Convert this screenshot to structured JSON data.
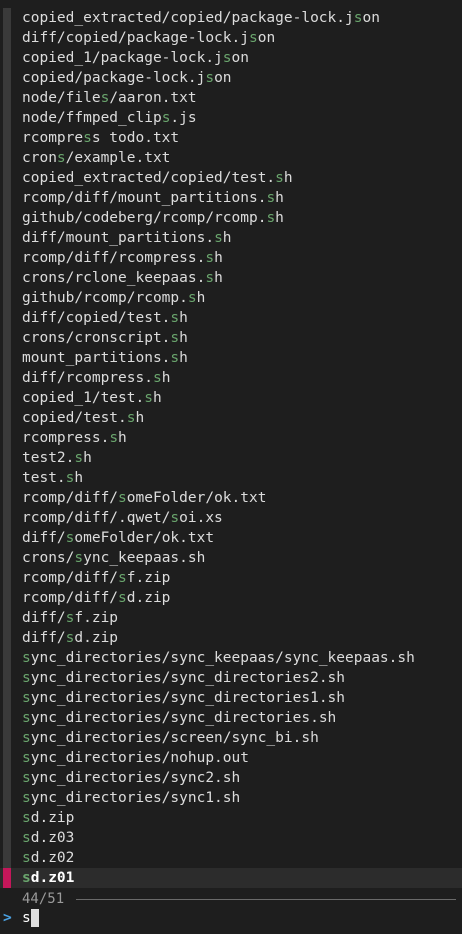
{
  "results": [
    [
      "copied_extracted/copied/package-lock.j",
      "s",
      "on"
    ],
    [
      "diff/copied/package-lock.j",
      "s",
      "on"
    ],
    [
      "copied_1/package-lock.j",
      "s",
      "on"
    ],
    [
      "copied/package-lock.j",
      "s",
      "on"
    ],
    [
      "node/file",
      "s",
      "/aaron.txt"
    ],
    [
      "node/ffmped_clip",
      "s",
      ".js"
    ],
    [
      "rcompre",
      "s",
      "s todo.txt"
    ],
    [
      "cron",
      "s",
      "/example.txt"
    ],
    [
      "copied_extracted/copied/test.",
      "s",
      "h"
    ],
    [
      "rcomp/diff/mount_partitions.",
      "s",
      "h"
    ],
    [
      "github/codeberg/rcomp/rcomp.",
      "s",
      "h"
    ],
    [
      "diff/mount_partitions.",
      "s",
      "h"
    ],
    [
      "rcomp/diff/rcompress.",
      "s",
      "h"
    ],
    [
      "crons/rclone_keepaas.",
      "s",
      "h"
    ],
    [
      "github/rcomp/rcomp.",
      "s",
      "h"
    ],
    [
      "diff/copied/test.",
      "s",
      "h"
    ],
    [
      "crons/cronscript.",
      "s",
      "h"
    ],
    [
      "mount_partitions.",
      "s",
      "h"
    ],
    [
      "diff/rcompress.",
      "s",
      "h"
    ],
    [
      "copied_1/test.",
      "s",
      "h"
    ],
    [
      "copied/test.",
      "s",
      "h"
    ],
    [
      "rcompress.",
      "s",
      "h"
    ],
    [
      "test2.",
      "s",
      "h"
    ],
    [
      "test.",
      "s",
      "h"
    ],
    [
      "rcomp/diff/",
      "s",
      "omeFolder/ok.txt"
    ],
    [
      "rcomp/diff/.qwet/",
      "s",
      "oi.xs"
    ],
    [
      "diff/",
      "s",
      "omeFolder/ok.txt"
    ],
    [
      "crons/",
      "s",
      "ync_keepaas.sh"
    ],
    [
      "rcomp/diff/",
      "s",
      "f.zip"
    ],
    [
      "rcomp/diff/",
      "s",
      "d.zip"
    ],
    [
      "diff/",
      "s",
      "f.zip"
    ],
    [
      "diff/",
      "s",
      "d.zip"
    ],
    [
      "",
      "s",
      "ync_directories/sync_keepaas/sync_keepaas.sh"
    ],
    [
      "",
      "s",
      "ync_directories/sync_directories2.sh"
    ],
    [
      "",
      "s",
      "ync_directories/sync_directories1.sh"
    ],
    [
      "",
      "s",
      "ync_directories/sync_directories.sh"
    ],
    [
      "",
      "s",
      "ync_directories/screen/sync_bi.sh"
    ],
    [
      "",
      "s",
      "ync_directories/nohup.out"
    ],
    [
      "",
      "s",
      "ync_directories/sync2.sh"
    ],
    [
      "",
      "s",
      "ync_directories/sync1.sh"
    ],
    [
      "",
      "s",
      "d.zip"
    ],
    [
      "",
      "s",
      "d.z03"
    ],
    [
      "",
      "s",
      "d.z02"
    ],
    [
      "",
      "s",
      "d.z01"
    ]
  ],
  "selected_index": 43,
  "info": {
    "count": "44/51"
  },
  "prompt": {
    "pointer": ">",
    "query": "s"
  },
  "colors": {
    "background": "#1e1e1e",
    "text": "#dcdcdc",
    "match": "#6aa56d",
    "selected_marker": "#c4175a",
    "pointer": "#4aa0e0"
  }
}
